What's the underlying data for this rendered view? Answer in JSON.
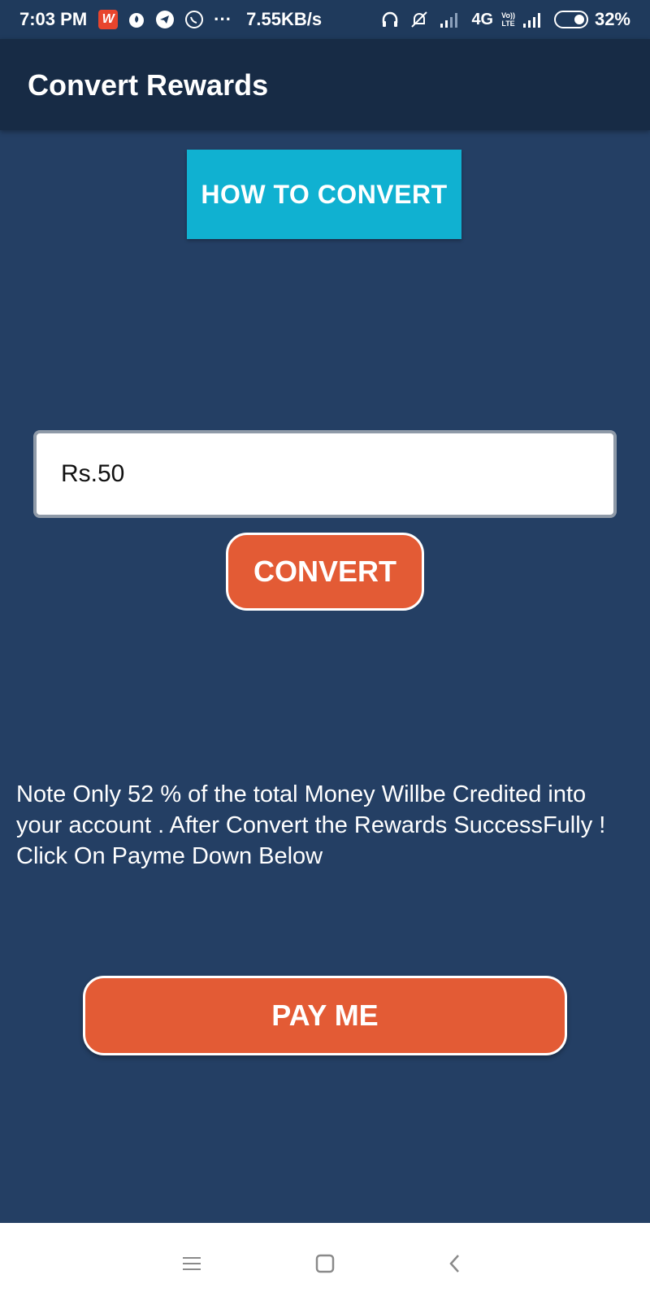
{
  "status_bar": {
    "time": "7:03 PM",
    "app_badge": "W",
    "more": "···",
    "speed": "7.55KB/s",
    "network": "4G",
    "volte_top": "Vo))",
    "volte_bottom": "LTE",
    "battery": "32%"
  },
  "app_bar": {
    "title": "Convert Rewards"
  },
  "main": {
    "how_to_convert_label": "HOW TO CONVERT",
    "amount_value": "Rs.50",
    "convert_label": "CONVERT",
    "note": "Note Only 52 % of the total Money Willbe Credited into your account . After Convert the Rewards SuccessFully ! Click On Payme Down Below",
    "pay_me_label": "PAY ME"
  },
  "icons": {
    "status": [
      "tinder-flame-icon",
      "telegram-icon",
      "whatsapp-icon",
      "headphones-icon",
      "mute-icon",
      "signal-icon",
      "battery-icon"
    ],
    "nav": [
      "menu-icon",
      "home-icon",
      "back-icon"
    ]
  },
  "colors": {
    "background": "#243f64",
    "app_bar": "#172b45",
    "accent_cyan": "#10b1d1",
    "accent_orange": "#e35b35"
  }
}
